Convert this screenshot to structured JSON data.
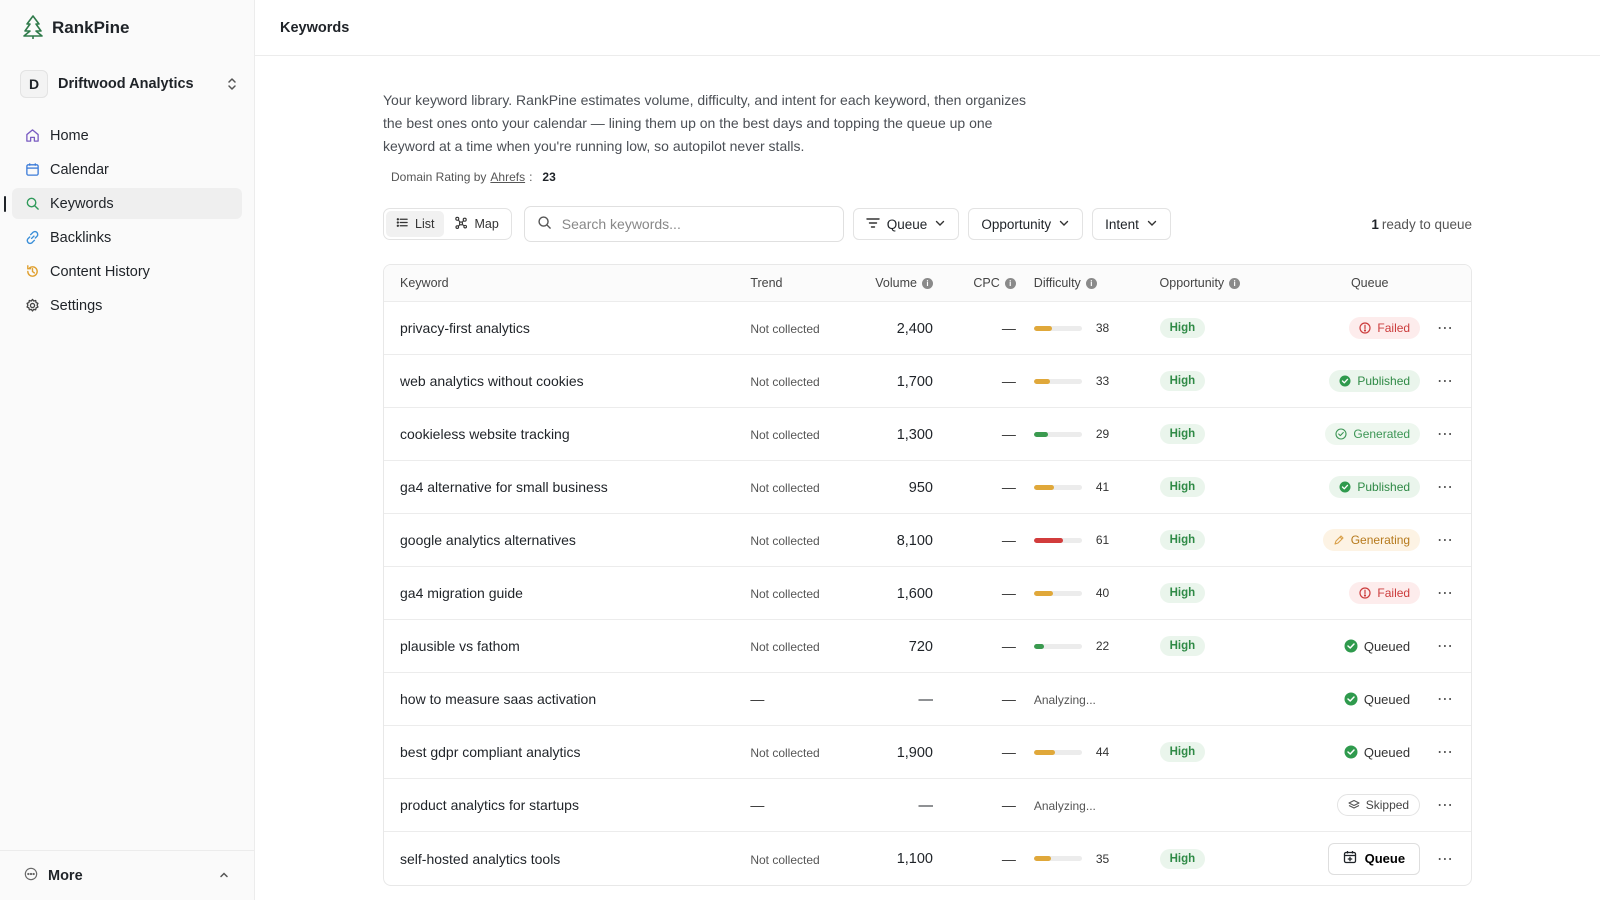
{
  "brand": {
    "name": "RankPine"
  },
  "workspace": {
    "initial": "D",
    "name": "Driftwood Analytics"
  },
  "nav": [
    {
      "label": "Home",
      "icon": "home-icon",
      "active": false
    },
    {
      "label": "Calendar",
      "icon": "calendar-icon",
      "active": false
    },
    {
      "label": "Keywords",
      "icon": "search-icon",
      "active": true
    },
    {
      "label": "Backlinks",
      "icon": "link-icon",
      "active": false
    },
    {
      "label": "Content History",
      "icon": "history-icon",
      "active": false
    },
    {
      "label": "Settings",
      "icon": "gear-icon",
      "active": false
    }
  ],
  "footer": {
    "label": "More"
  },
  "page": {
    "title": "Keywords",
    "description": "Your keyword library. RankPine estimates volume, difficulty, and intent for each keyword, then organizes the best ones onto your calendar — lining them up on the best days and topping the queue up one keyword at a time when you're running low, so autopilot never stalls.",
    "dr_prefix": "Domain Rating by",
    "dr_link": "Ahrefs",
    "dr_sep": ":",
    "dr_value": "23"
  },
  "toolbar": {
    "view_list": "List",
    "view_map": "Map",
    "search_placeholder": "Search keywords...",
    "filter_queue": "Queue",
    "filter_opportunity": "Opportunity",
    "filter_intent": "Intent",
    "ready_count": "1",
    "ready_text": "ready to queue"
  },
  "table": {
    "headers": {
      "keyword": "Keyword",
      "trend": "Trend",
      "volume": "Volume",
      "cpc": "CPC",
      "difficulty": "Difficulty",
      "opportunity": "Opportunity",
      "queue": "Queue"
    },
    "rows": [
      {
        "keyword": "privacy-first analytics",
        "trend": "Not collected",
        "volume": "2,400",
        "cpc": "—",
        "difficulty": 38,
        "difficulty_color": "#e0a83a",
        "opportunity": "High",
        "status": "Failed",
        "status_type": "failed"
      },
      {
        "keyword": "web analytics without cookies",
        "trend": "Not collected",
        "volume": "1,700",
        "cpc": "—",
        "difficulty": 33,
        "difficulty_color": "#e0a83a",
        "opportunity": "High",
        "status": "Published",
        "status_type": "published"
      },
      {
        "keyword": "cookieless website tracking",
        "trend": "Not collected",
        "volume": "1,300",
        "cpc": "—",
        "difficulty": 29,
        "difficulty_color": "#3a9a4f",
        "opportunity": "High",
        "status": "Generated",
        "status_type": "generated"
      },
      {
        "keyword": "ga4 alternative for small business",
        "trend": "Not collected",
        "volume": "950",
        "cpc": "—",
        "difficulty": 41,
        "difficulty_color": "#e0a83a",
        "opportunity": "High",
        "status": "Published",
        "status_type": "published"
      },
      {
        "keyword": "google analytics alternatives",
        "trend": "Not collected",
        "volume": "8,100",
        "cpc": "—",
        "difficulty": 61,
        "difficulty_color": "#d23c3c",
        "opportunity": "High",
        "status": "Generating",
        "status_type": "generating"
      },
      {
        "keyword": "ga4 migration guide",
        "trend": "Not collected",
        "volume": "1,600",
        "cpc": "—",
        "difficulty": 40,
        "difficulty_color": "#e0a83a",
        "opportunity": "High",
        "status": "Failed",
        "status_type": "failed"
      },
      {
        "keyword": "plausible vs fathom",
        "trend": "Not collected",
        "volume": "720",
        "cpc": "—",
        "difficulty": 22,
        "difficulty_color": "#3a9a4f",
        "opportunity": "High",
        "status": "Queued",
        "status_type": "queued"
      },
      {
        "keyword": "how to measure saas activation",
        "trend": "—",
        "volume": "—",
        "cpc": "—",
        "difficulty": null,
        "difficulty_text": "Analyzing...",
        "opportunity": "",
        "status": "Queued",
        "status_type": "queued"
      },
      {
        "keyword": "best gdpr compliant analytics",
        "trend": "Not collected",
        "volume": "1,900",
        "cpc": "—",
        "difficulty": 44,
        "difficulty_color": "#e0a83a",
        "opportunity": "High",
        "status": "Queued",
        "status_type": "queued"
      },
      {
        "keyword": "product analytics for startups",
        "trend": "—",
        "volume": "—",
        "cpc": "—",
        "difficulty": null,
        "difficulty_text": "Analyzing...",
        "opportunity": "",
        "status": "Skipped",
        "status_type": "skipped"
      },
      {
        "keyword": "self-hosted analytics tools",
        "trend": "Not collected",
        "volume": "1,100",
        "cpc": "—",
        "difficulty": 35,
        "difficulty_color": "#e0a83a",
        "opportunity": "High",
        "status": "Queue",
        "status_type": "queue-button"
      }
    ]
  }
}
